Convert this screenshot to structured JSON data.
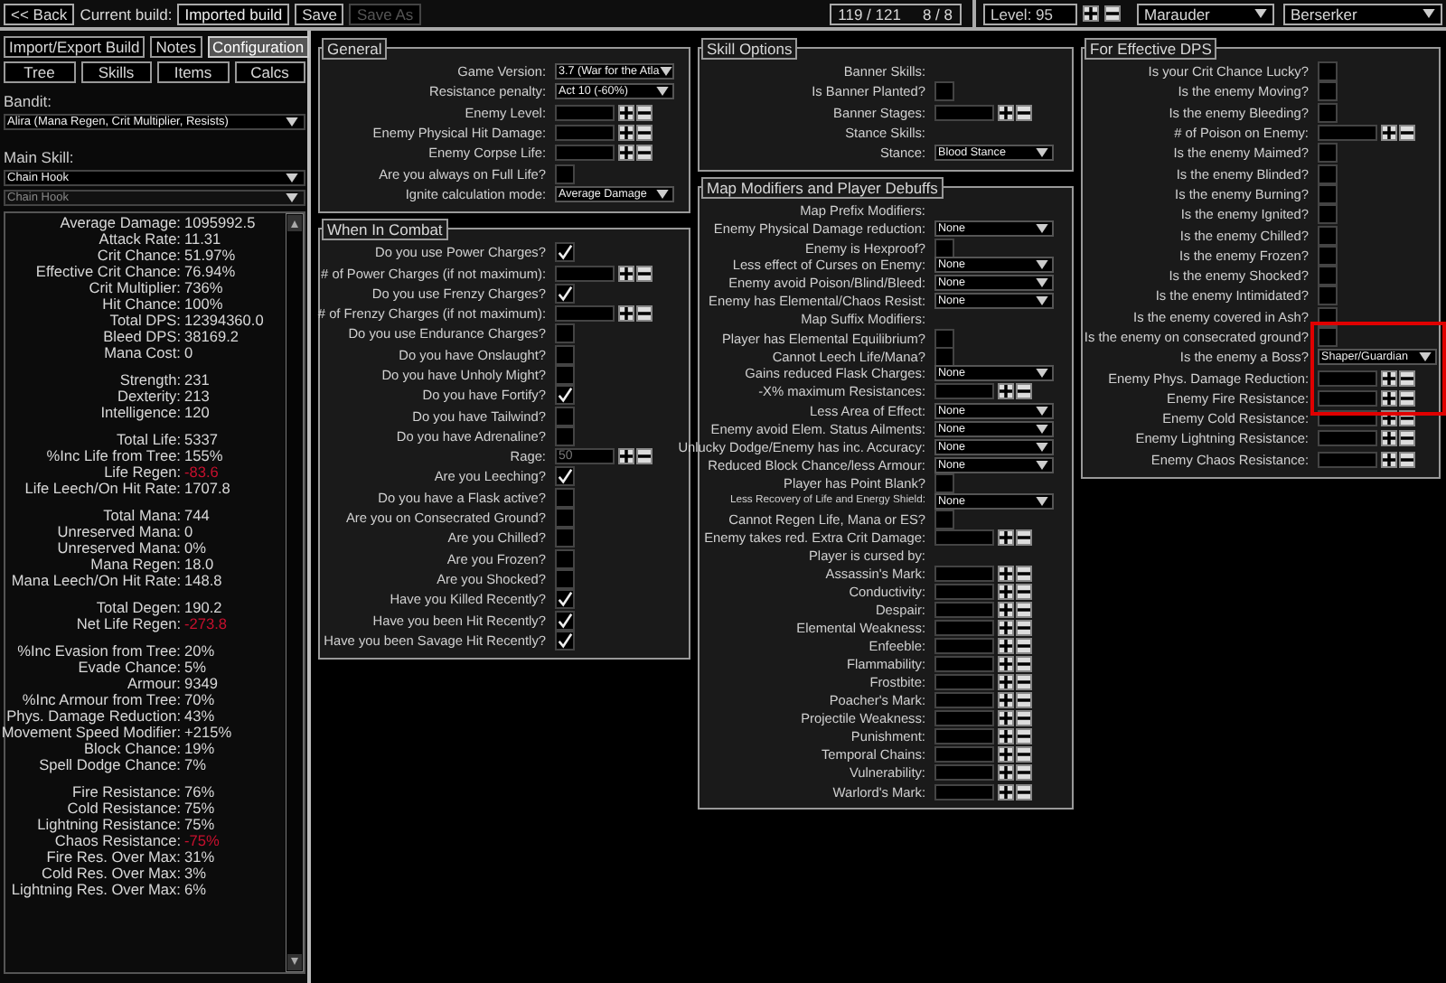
{
  "top_bar": {
    "back_button": "<< Back",
    "current_build_label": "Current build:",
    "build_name": "Imported build",
    "save_button": "Save",
    "save_as": {
      "label": "Save As",
      "disabled": true
    },
    "points": [
      "119 / 121",
      "8 / 8"
    ],
    "level": "Level: 95",
    "class_select": "Marauder",
    "ascendancy_select": "Berserker"
  },
  "sidebar": {
    "tabs": [
      {
        "label": "Import/Export Build",
        "selected": false
      },
      {
        "label": "Notes",
        "selected": false
      },
      {
        "label": "Configuration",
        "selected": true
      }
    ],
    "sub_tabs": [
      "Tree",
      "Skills",
      "Items",
      "Calcs"
    ],
    "bandit_label": "Bandit:",
    "bandit_select": "Alira (Mana Regen, Crit Multiplier, Resists)",
    "main_skill_label": "Main Skill:",
    "main_skill_selects": [
      {
        "value": "Chain Hook",
        "disabled": false
      },
      {
        "value": "Chain Hook",
        "disabled": true
      }
    ],
    "stat_groups": [
      [
        {
          "label": "Average Damage:",
          "value": "1095992.5",
          "alert": false
        },
        {
          "label": "Attack Rate:",
          "value": "11.31",
          "alert": false
        },
        {
          "label": "Crit Chance:",
          "value": "51.97%",
          "alert": false
        },
        {
          "label": "Effective Crit Chance:",
          "value": "76.94%",
          "alert": false
        },
        {
          "label": "Crit Multiplier:",
          "value": "736%",
          "alert": false
        },
        {
          "label": "Hit Chance:",
          "value": "100%",
          "alert": false
        },
        {
          "label": "Total DPS:",
          "value": "12394360.0",
          "alert": false
        },
        {
          "label": "Bleed DPS:",
          "value": "38169.2",
          "alert": false
        },
        {
          "label": "Mana Cost:",
          "value": "0",
          "alert": false
        }
      ],
      [
        {
          "label": "Strength:",
          "value": "231",
          "alert": false
        },
        {
          "label": "Dexterity:",
          "value": "213",
          "alert": false
        },
        {
          "label": "Intelligence:",
          "value": "120",
          "alert": false
        }
      ],
      [
        {
          "label": "Total Life:",
          "value": "5337",
          "alert": false
        },
        {
          "label": "%Inc Life from Tree:",
          "value": "155%",
          "alert": false
        },
        {
          "label": "Life Regen:",
          "value": "-83.6",
          "alert": true
        },
        {
          "label": "Life Leech/On Hit Rate:",
          "value": "1707.8",
          "alert": false
        }
      ],
      [
        {
          "label": "Total Mana:",
          "value": "744",
          "alert": false
        },
        {
          "label": "Unreserved Mana:",
          "value": "0",
          "alert": false
        },
        {
          "label": "Unreserved Mana:",
          "value": "0%",
          "alert": false
        },
        {
          "label": "Mana Regen:",
          "value": "18.0",
          "alert": false
        },
        {
          "label": "Mana Leech/On Hit Rate:",
          "value": "148.8",
          "alert": false
        }
      ],
      [
        {
          "label": "Total Degen:",
          "value": "190.2",
          "alert": false
        },
        {
          "label": "Net Life Regen:",
          "value": "-273.8",
          "alert": true
        }
      ],
      [
        {
          "label": "%Inc Evasion from Tree:",
          "value": "20%",
          "alert": false
        },
        {
          "label": "Evade Chance:",
          "value": "5%",
          "alert": false
        },
        {
          "label": "Armour:",
          "value": "9349",
          "alert": false
        },
        {
          "label": "%Inc Armour from Tree:",
          "value": "70%",
          "alert": false
        },
        {
          "label": "Phys. Damage Reduction:",
          "value": "43%",
          "alert": false
        },
        {
          "label": "Movement Speed Modifier:",
          "value": "+215%",
          "alert": false
        },
        {
          "label": "Block Chance:",
          "value": "19%",
          "alert": false
        },
        {
          "label": "Spell Dodge Chance:",
          "value": "7%",
          "alert": false
        }
      ],
      [
        {
          "label": "Fire Resistance:",
          "value": "76%",
          "alert": false
        },
        {
          "label": "Cold Resistance:",
          "value": "75%",
          "alert": false
        },
        {
          "label": "Lightning Resistance:",
          "value": "75%",
          "alert": false
        },
        {
          "label": "Chaos Resistance:",
          "value": "-75%",
          "alert": true
        },
        {
          "label": "Fire Res. Over Max:",
          "value": "31%",
          "alert": false
        },
        {
          "label": "Cold Res. Over Max:",
          "value": "3%",
          "alert": false
        },
        {
          "label": "Lightning Res. Over Max:",
          "value": "6%",
          "alert": false
        }
      ]
    ]
  },
  "columns": [
    {
      "panels": [
        {
          "title": "General",
          "rows": [
            {
              "kind": "select",
              "label": "Game Version:",
              "value": "3.7 (War for the Atla"
            },
            {
              "kind": "select",
              "label": "Resistance penalty:",
              "value": "Act 10 (-60%)"
            },
            {
              "kind": "count",
              "label": "Enemy Level:"
            },
            {
              "kind": "count",
              "label": "Enemy Physical Hit Damage:"
            },
            {
              "kind": "count",
              "label": "Enemy Corpse Life:"
            },
            {
              "kind": "check",
              "label": "Are you always on Full Life?",
              "checked": false
            },
            {
              "kind": "select",
              "label": "Ignite calculation mode:",
              "value": "Average Damage"
            }
          ]
        },
        {
          "title": "When In Combat",
          "rows": [
            {
              "kind": "check",
              "label": "Do you use Power Charges?",
              "checked": true
            },
            {
              "kind": "count",
              "label": "# of Power Charges (if not maximum):"
            },
            {
              "kind": "check",
              "label": "Do you use Frenzy Charges?",
              "checked": true
            },
            {
              "kind": "count",
              "label": "# of Frenzy Charges (if not maximum):"
            },
            {
              "kind": "check",
              "label": "Do you use Endurance Charges?",
              "checked": false
            },
            {
              "kind": "check",
              "label": "Do you have Onslaught?",
              "checked": false
            },
            {
              "kind": "check",
              "label": "Do you have Unholy Might?",
              "checked": false
            },
            {
              "kind": "check",
              "label": "Do you have Fortify?",
              "checked": true
            },
            {
              "kind": "check",
              "label": "Do you have Tailwind?",
              "checked": false
            },
            {
              "kind": "check",
              "label": "Do you have Adrenaline?",
              "checked": false
            },
            {
              "kind": "count",
              "label": "Rage:",
              "placeholder": "50"
            },
            {
              "kind": "check",
              "label": "Are you Leeching?",
              "checked": true
            },
            {
              "kind": "check",
              "label": "Do you have a Flask active?",
              "checked": false
            },
            {
              "kind": "check",
              "label": "Are you on Consecrated Ground?",
              "checked": false
            },
            {
              "kind": "check",
              "label": "Are you Chilled?",
              "checked": false
            },
            {
              "kind": "check",
              "label": "Are you Frozen?",
              "checked": false
            },
            {
              "kind": "check",
              "label": "Are you Shocked?",
              "checked": false
            },
            {
              "kind": "check",
              "label": "Have you Killed Recently?",
              "checked": true
            },
            {
              "kind": "check",
              "label": "Have you been Hit Recently?",
              "checked": true
            },
            {
              "kind": "check",
              "label": "Have you been Savage Hit Recently?",
              "checked": true
            }
          ]
        }
      ]
    },
    {
      "panels": [
        {
          "title": "Skill Options",
          "rows": [
            {
              "kind": "heading",
              "label": "Banner Skills:"
            },
            {
              "kind": "check",
              "label": "Is Banner Planted?",
              "checked": false
            },
            {
              "kind": "count",
              "label": "Banner Stages:"
            },
            {
              "kind": "heading",
              "label": "Stance Skills:"
            },
            {
              "kind": "select",
              "label": "Stance:",
              "value": "Blood Stance"
            }
          ]
        },
        {
          "title": "Map Modifiers and Player Debuffs",
          "rows": [
            {
              "kind": "heading",
              "label": "Map Prefix Modifiers:"
            },
            {
              "kind": "select",
              "label": "Enemy Physical Damage reduction:",
              "value": "None"
            },
            {
              "kind": "check",
              "label": "Enemy is Hexproof?",
              "checked": false
            },
            {
              "kind": "select",
              "label": "Less effect of Curses on Enemy:",
              "value": "None"
            },
            {
              "kind": "select",
              "label": "Enemy avoid Poison/Blind/Bleed:",
              "value": "None"
            },
            {
              "kind": "select",
              "label": "Enemy has Elemental/Chaos Resist:",
              "value": "None"
            },
            {
              "kind": "heading",
              "label": "Map Suffix Modifiers:"
            },
            {
              "kind": "check",
              "label": "Player has Elemental Equilibrium?",
              "checked": false
            },
            {
              "kind": "check",
              "label": "Cannot Leech Life/Mana?",
              "checked": false
            },
            {
              "kind": "select",
              "label": "Gains reduced Flask Charges:",
              "value": "None"
            },
            {
              "kind": "count",
              "label": "-X% maximum Resistances:"
            },
            {
              "kind": "select",
              "label": "Less Area of Effect:",
              "value": "None"
            },
            {
              "kind": "select",
              "label": "Enemy avoid Elem. Status Ailments:",
              "value": "None"
            },
            {
              "kind": "select",
              "label": "Unlucky Dodge/Enemy has inc. Accuracy:",
              "value": "None"
            },
            {
              "kind": "select",
              "label": "Reduced Block Chance/less Armour:",
              "value": "None"
            },
            {
              "kind": "check",
              "label": "Player has Point Blank?",
              "checked": false
            },
            {
              "kind": "select",
              "label": "Less Recovery of Life and Energy Shield:",
              "value": "None"
            },
            {
              "kind": "check",
              "label": "Cannot Regen Life, Mana or ES?",
              "checked": false
            },
            {
              "kind": "count",
              "label": "Enemy takes red. Extra Crit Damage:"
            },
            {
              "kind": "heading",
              "label": "Player is cursed by:"
            },
            {
              "kind": "count",
              "label": "Assassin's Mark:"
            },
            {
              "kind": "count",
              "label": "Conductivity:"
            },
            {
              "kind": "count",
              "label": "Despair:"
            },
            {
              "kind": "count",
              "label": "Elemental Weakness:"
            },
            {
              "kind": "count",
              "label": "Enfeeble:"
            },
            {
              "kind": "count",
              "label": "Flammability:"
            },
            {
              "kind": "count",
              "label": "Frostbite:"
            },
            {
              "kind": "count",
              "label": "Poacher's Mark:"
            },
            {
              "kind": "count",
              "label": "Projectile Weakness:"
            },
            {
              "kind": "count",
              "label": "Punishment:"
            },
            {
              "kind": "count",
              "label": "Temporal Chains:"
            },
            {
              "kind": "count",
              "label": "Vulnerability:"
            },
            {
              "kind": "count",
              "label": "Warlord's Mark:"
            }
          ]
        }
      ]
    },
    {
      "panels": [
        {
          "title": "For Effective DPS",
          "rows": [
            {
              "kind": "check",
              "label": "Is your Crit Chance Lucky?",
              "checked": false
            },
            {
              "kind": "check",
              "label": "Is the enemy Moving?",
              "checked": false
            },
            {
              "kind": "check",
              "label": "Is the enemy Bleeding?",
              "checked": false
            },
            {
              "kind": "count",
              "label": "# of Poison on Enemy:"
            },
            {
              "kind": "check",
              "label": "Is the enemy Maimed?",
              "checked": false
            },
            {
              "kind": "check",
              "label": "Is the enemy Blinded?",
              "checked": false
            },
            {
              "kind": "check",
              "label": "Is the enemy Burning?",
              "checked": false
            },
            {
              "kind": "check",
              "label": "Is the enemy Ignited?",
              "checked": false
            },
            {
              "kind": "check",
              "label": "Is the enemy Chilled?",
              "checked": false
            },
            {
              "kind": "check",
              "label": "Is the enemy Frozen?",
              "checked": false
            },
            {
              "kind": "check",
              "label": "Is the enemy Shocked?",
              "checked": false
            },
            {
              "kind": "check",
              "label": "Is the enemy Intimidated?",
              "checked": false
            },
            {
              "kind": "check",
              "label": "Is the enemy covered in Ash?",
              "checked": false
            },
            {
              "kind": "check",
              "label": "Is the enemy on consecrated ground?",
              "checked": false
            },
            {
              "kind": "select",
              "label": "Is the enemy a Boss?",
              "value": "Shaper/Guardian"
            },
            {
              "kind": "count",
              "label": "Enemy Phys. Damage Reduction:"
            },
            {
              "kind": "count",
              "label": "Enemy Fire Resistance:"
            },
            {
              "kind": "count",
              "label": "Enemy Cold Resistance:"
            },
            {
              "kind": "count",
              "label": "Enemy Lightning Resistance:"
            },
            {
              "kind": "count",
              "label": "Enemy Chaos Resistance:"
            }
          ]
        }
      ]
    }
  ]
}
